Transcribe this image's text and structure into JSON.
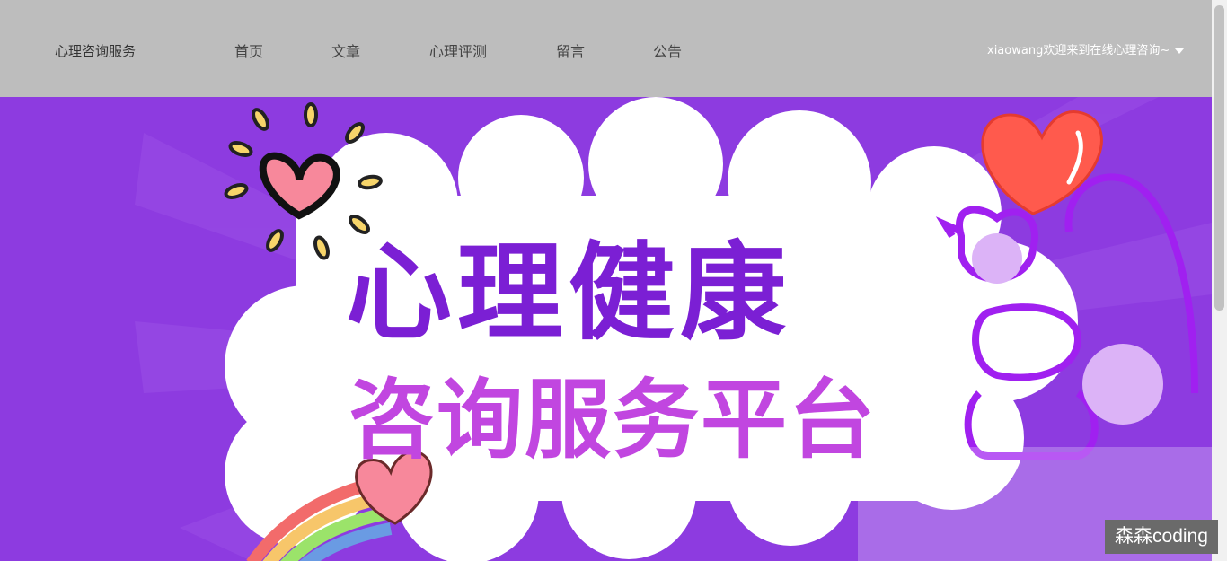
{
  "header": {
    "brand": "心理咨询服务",
    "nav": [
      {
        "label": "首页"
      },
      {
        "label": "文章"
      },
      {
        "label": "心理评测"
      },
      {
        "label": "留言"
      },
      {
        "label": "公告"
      }
    ],
    "user_greeting": "xiaowang欢迎来到在线心理咨询~"
  },
  "banner": {
    "title_line1": "心理健康",
    "title_line2": "咨询服务平台"
  },
  "watermark": "森森coding",
  "colors": {
    "header_bg": "#bdbdbd",
    "banner_bg": "#8d3be0",
    "title_primary": "#7b1fd4",
    "title_secondary": "#c146e0",
    "heart_red": "#ff5a4d",
    "heart_pink": "#f7889b"
  }
}
